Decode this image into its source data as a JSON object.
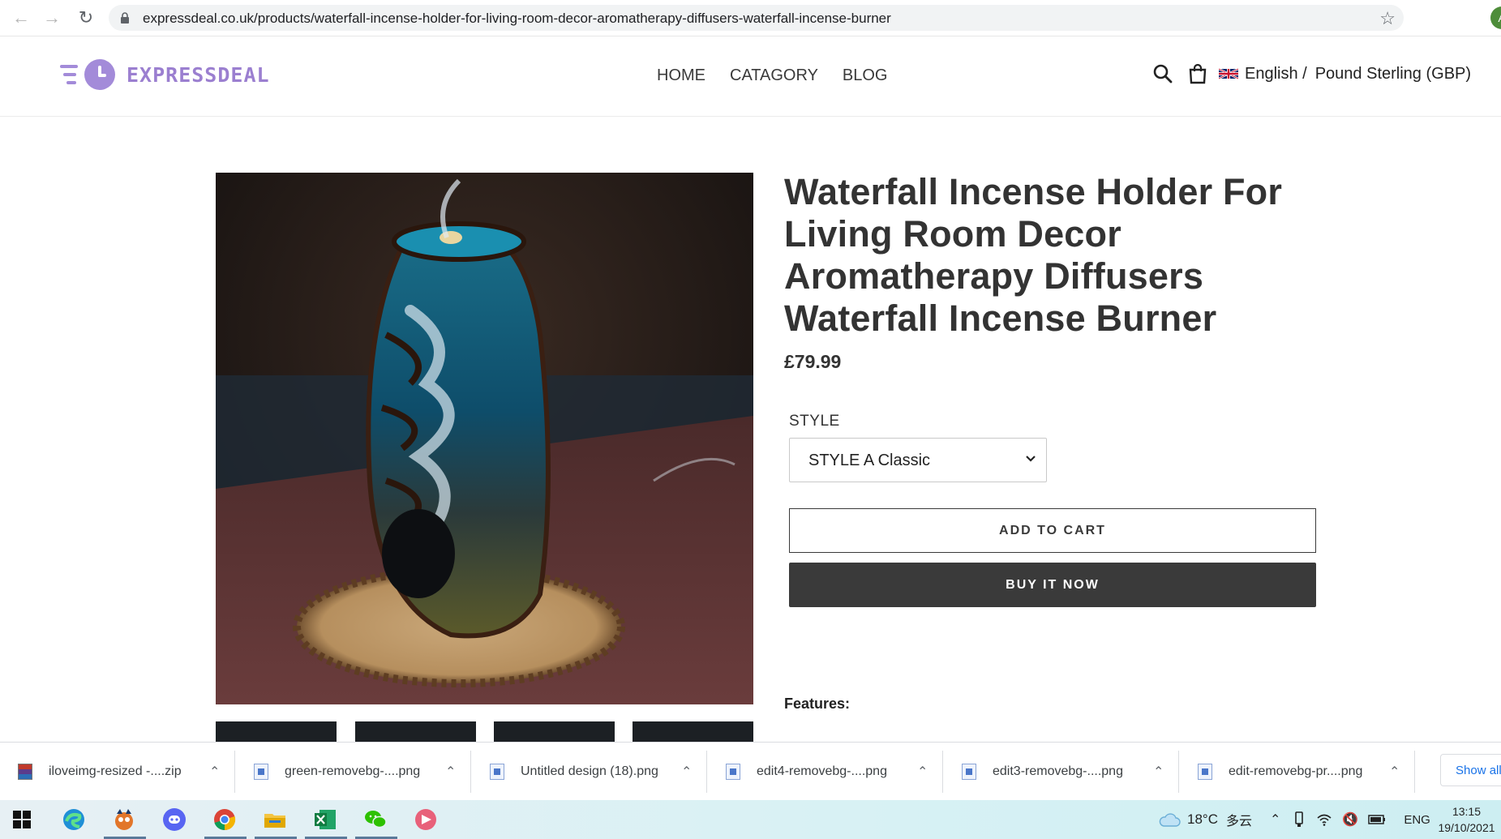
{
  "browser": {
    "url": "expressdeal.co.uk/products/waterfall-incense-holder-for-living-room-decor-aromatherapy-diffusers-waterfall-incense-burner",
    "profile_initial": "A"
  },
  "site": {
    "logo_text": "EXPRESSDEAL",
    "nav": [
      "HOME",
      "CATAGORY",
      "BLOG"
    ],
    "language": "English /",
    "currency": "Pound Sterling (GBP)",
    "accent_color": "#9b7fd0"
  },
  "product": {
    "title": "Waterfall Incense Holder For Living Room Decor Aromatherapy Diffusers Waterfall Incense Burner",
    "price": "£79.99",
    "style_label": "STYLE",
    "style_value": "STYLE A Classic",
    "add_to_cart": "ADD TO CART",
    "buy_now": "BUY IT NOW",
    "features_heading": "Features:"
  },
  "downloads": {
    "items": [
      {
        "name": "iloveimg-resized -....zip",
        "icon": "zip-archive-icon"
      },
      {
        "name": "green-removebg-....png",
        "icon": "image-file-icon"
      },
      {
        "name": "Untitled design (18).png",
        "icon": "image-file-icon"
      },
      {
        "name": "edit4-removebg-....png",
        "icon": "image-file-icon"
      },
      {
        "name": "edit3-removebg-....png",
        "icon": "image-file-icon"
      },
      {
        "name": "edit-removebg-pr....png",
        "icon": "image-file-icon"
      }
    ],
    "show_all": "Show all"
  },
  "taskbar": {
    "apps": [
      "windows-start-icon",
      "edge-icon",
      "game-app-icon",
      "discord-icon",
      "chrome-icon",
      "file-explorer-icon",
      "excel-icon",
      "wechat-icon",
      "media-player-icon"
    ],
    "weather_temp": "18°C",
    "weather_desc": "多云",
    "input_lang": "ENG",
    "time": "13:15",
    "date": "19/10/2021"
  }
}
